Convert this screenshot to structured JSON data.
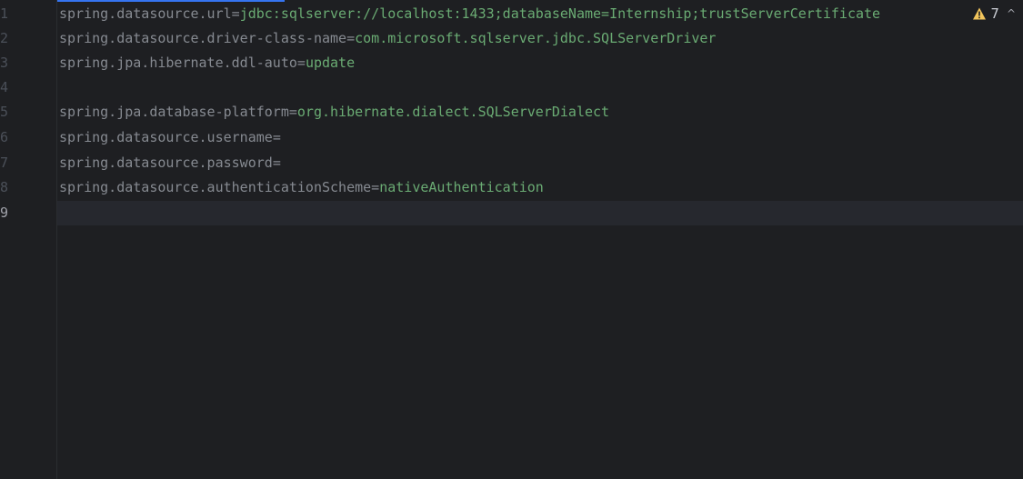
{
  "editor": {
    "lines": [
      {
        "number": "1",
        "key": "spring.datasource.url",
        "value": "jdbc:sqlserver://localhost:1433;databaseName=Internship;trustServerCertificate"
      },
      {
        "number": "2",
        "key": "spring.datasource.driver-class-name",
        "value": "com.microsoft.sqlserver.jdbc.SQLServerDriver"
      },
      {
        "number": "3",
        "key": "spring.jpa.hibernate.ddl-auto",
        "value": "update"
      },
      {
        "number": "4",
        "key": "",
        "value": ""
      },
      {
        "number": "5",
        "key": "spring.jpa.database-platform",
        "value": "org.hibernate.dialect.SQLServerDialect"
      },
      {
        "number": "6",
        "key": "spring.datasource.username",
        "value": ""
      },
      {
        "number": "7",
        "key": "spring.datasource.password",
        "value": ""
      },
      {
        "number": "8",
        "key": "spring.datasource.authenticationScheme",
        "value": "nativeAuthentication"
      },
      {
        "number": "9",
        "key": "",
        "value": ""
      }
    ],
    "current_line": "9",
    "inspection": {
      "icon": "warning-icon",
      "count": "7",
      "chevron": "^"
    }
  },
  "colors": {
    "background": "#1e1f22",
    "key": "#868a91",
    "value": "#6aab73",
    "accent": "#3574f0",
    "warning": "#f2c55c"
  }
}
